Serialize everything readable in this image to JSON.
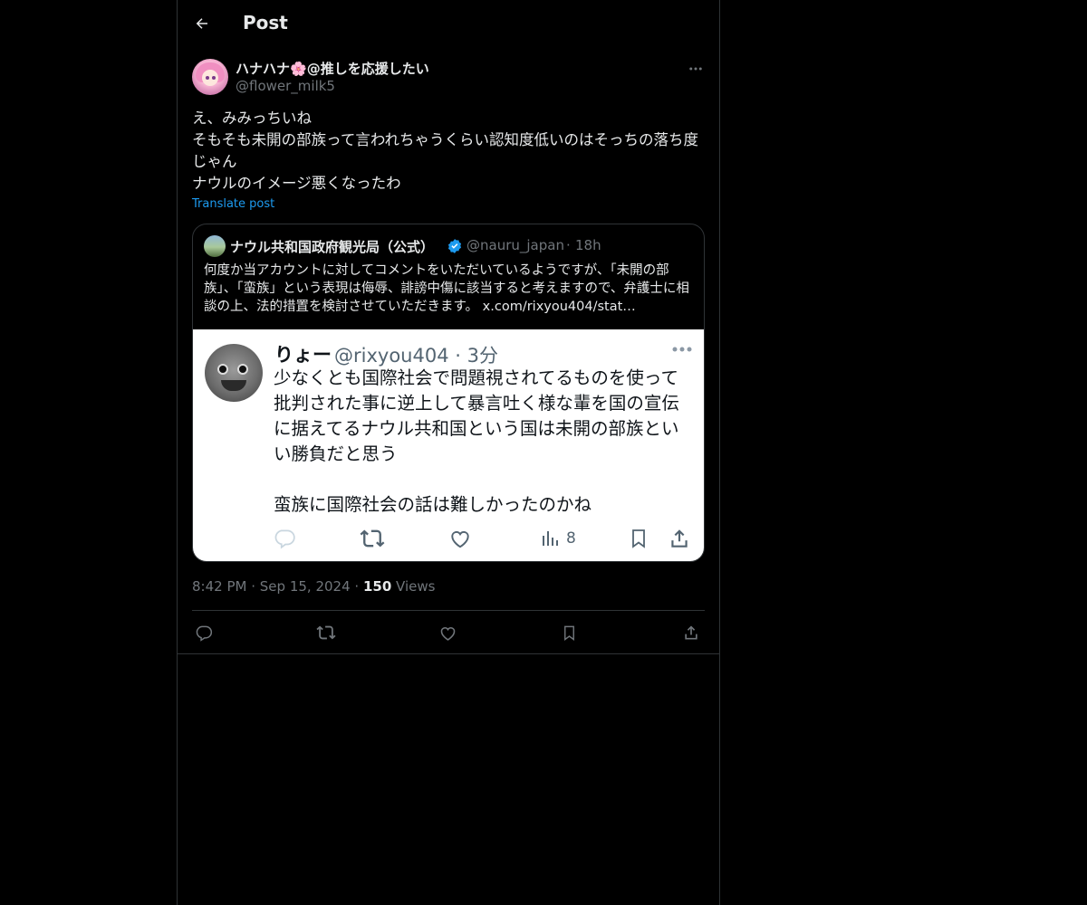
{
  "header": {
    "title": "Post"
  },
  "post": {
    "author": {
      "display_name_before": "ハナハナ",
      "display_name_emoji": "🌸",
      "display_name_after": "@推しを応援したい",
      "handle": "@flower_milk5"
    },
    "text": "え、みみっちいね\nそもそも未開の部族って言われちゃうくらい認知度低いのはそっちの落ち度じゃん\nナウルのイメージ悪くなったわ",
    "translate_label": "Translate post",
    "timestamp": "8:42 PM",
    "date": "Sep 15, 2024",
    "views_count": "150",
    "views_label": "Views"
  },
  "quote": {
    "author_name": "ナウル共和国政府観光局（公式）",
    "verified": true,
    "handle": "@nauru_japan",
    "separator": "·",
    "time": "18h",
    "text": "何度か当アカウントに対してコメントをいただいているようですが、「未開の部族」、「蛮族」という表現は侮辱、誹謗中傷に該当すると考えますので、弁護士に相談の上、法的措置を検討させていただきます。 x.com/rixyou404/stat…",
    "image": {
      "author_name": "りょー",
      "handle_time": "@rixyou404 · 3分",
      "text": "少なくとも国際社会で問題視されてるものを使って批判された事に逆上して暴言吐く様な輩を国の宣伝に据えてるナウル共和国という国は未開の部族といい勝負だと思う\n\n蛮族に国際社会の話は難しかったのかね",
      "views_count": "8"
    }
  },
  "colors": {
    "background": "#000000",
    "text": "#e7e9ea",
    "secondary": "#71767b",
    "accent": "#1d9bf0",
    "border": "#2f3336"
  }
}
